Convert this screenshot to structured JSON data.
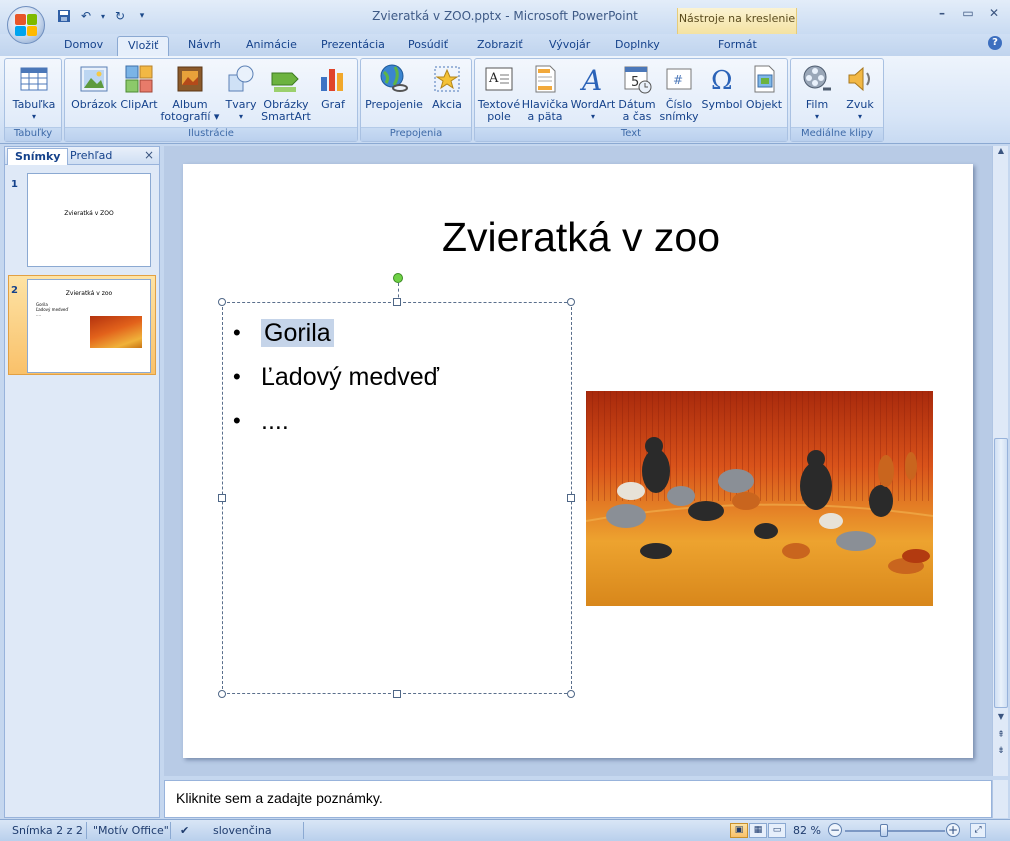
{
  "window": {
    "title": "Zvieratká v ZOO.pptx - Microsoft PowerPoint",
    "context_tab_header": "Nástroje na kreslenie"
  },
  "tabs": [
    {
      "label": "Domov"
    },
    {
      "label": "Vložiť"
    },
    {
      "label": "Návrh"
    },
    {
      "label": "Animácie"
    },
    {
      "label": "Prezentácia"
    },
    {
      "label": "Posúdiť"
    },
    {
      "label": "Zobraziť"
    },
    {
      "label": "Vývojár"
    },
    {
      "label": "Doplnky"
    },
    {
      "label": "Formát"
    }
  ],
  "active_tab": "Vložiť",
  "ribbon": {
    "groups": [
      {
        "label": "Tabuľky"
      },
      {
        "label": "Ilustrácie"
      },
      {
        "label": "Prepojenia"
      },
      {
        "label": "Text"
      },
      {
        "label": "Mediálne klipy"
      }
    ],
    "buttons": {
      "tabulka": {
        "line1": "Tabuľka",
        "line2": "▾"
      },
      "obrazok": {
        "line1": "Obrázok"
      },
      "clipart": {
        "line1": "ClipArt"
      },
      "album": {
        "line1": "Album",
        "line2": "fotografií ▾"
      },
      "tvary": {
        "line1": "Tvary",
        "line2": "▾"
      },
      "smartart": {
        "line1": "Obrázky",
        "line2": "SmartArt"
      },
      "graf": {
        "line1": "Graf"
      },
      "prepojenie": {
        "line1": "Prepojenie"
      },
      "akcia": {
        "line1": "Akcia"
      },
      "textove_pole": {
        "line1": "Textové",
        "line2": "pole"
      },
      "hlavicka": {
        "line1": "Hlavička",
        "line2": "a päta"
      },
      "wordart": {
        "line1": "WordArt",
        "line2": "▾"
      },
      "datum": {
        "line1": "Dátum",
        "line2": "a čas"
      },
      "cislo": {
        "line1": "Číslo",
        "line2": "snímky"
      },
      "symbol": {
        "line1": "Symbol"
      },
      "objekt": {
        "line1": "Objekt"
      },
      "film": {
        "line1": "Film",
        "line2": "▾"
      },
      "zvuk": {
        "line1": "Zvuk",
        "line2": "▾"
      }
    }
  },
  "left_pane": {
    "tabs": [
      "Snímky",
      "Prehľad"
    ],
    "close": "×",
    "thumbnails": [
      {
        "number": "1",
        "title": "Zvieratká v ZOO"
      },
      {
        "number": "2",
        "title": "Zvieratká v zoo",
        "bullets": [
          "Gorila",
          "Ľadový medveď",
          "...."
        ]
      }
    ]
  },
  "slide": {
    "title": "Zvieratká v zoo",
    "bullets": [
      "Gorila",
      "Ľadový medveď",
      "...."
    ],
    "highlighted_bullet": 0
  },
  "notes": {
    "placeholder": "Kliknite sem a zadajte poznámky."
  },
  "status": {
    "slide_info": "Snímka 2 z 2",
    "theme": "\"Motív Office\"",
    "language": "slovenčina",
    "zoom": "82 %",
    "zoom_percent": 82
  },
  "colors": {
    "ribbon_text": "#15428b",
    "selection": "#f9c16a",
    "context_tab": "#f4e2a2"
  }
}
